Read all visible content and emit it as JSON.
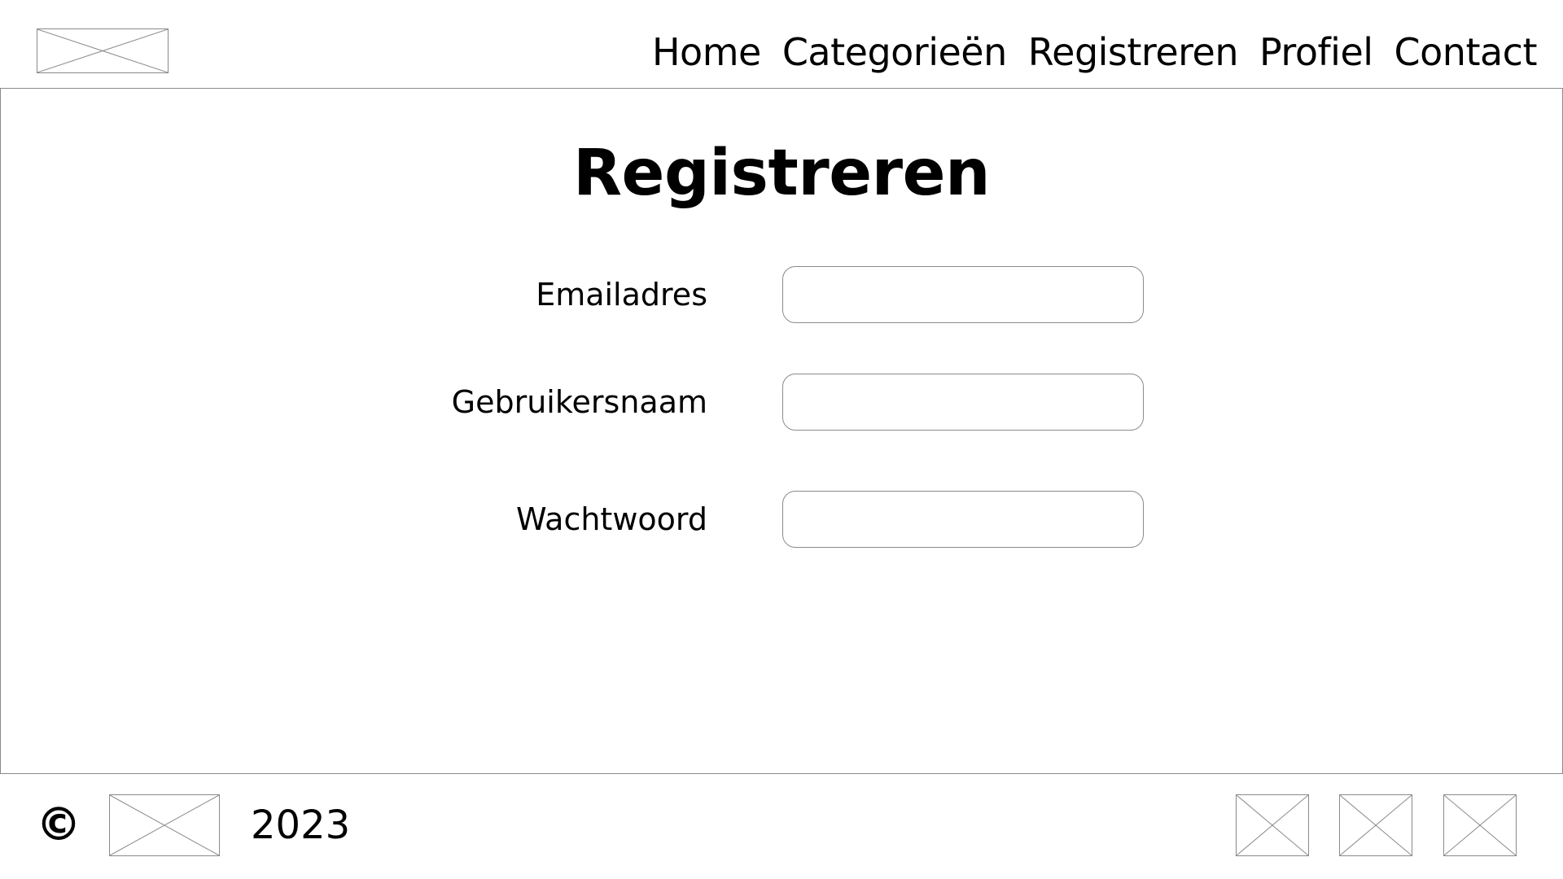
{
  "header": {
    "logo_icon": "image-placeholder-icon",
    "nav": [
      {
        "label": "Home"
      },
      {
        "label": "Categorieën"
      },
      {
        "label": "Registreren"
      },
      {
        "label": "Profiel"
      },
      {
        "label": "Contact"
      }
    ]
  },
  "main": {
    "title": "Registreren",
    "form": {
      "email": {
        "label": "Emailadres",
        "value": "",
        "placeholder": ""
      },
      "username": {
        "label": "Gebruikersnaam",
        "value": "",
        "placeholder": ""
      },
      "password": {
        "label": "Wachtwoord",
        "value": "",
        "placeholder": ""
      }
    }
  },
  "footer": {
    "copyright_symbol": "©",
    "logo_icon": "image-placeholder-icon",
    "year": "2023",
    "social_icons": [
      "image-placeholder-icon",
      "image-placeholder-icon",
      "image-placeholder-icon"
    ]
  }
}
